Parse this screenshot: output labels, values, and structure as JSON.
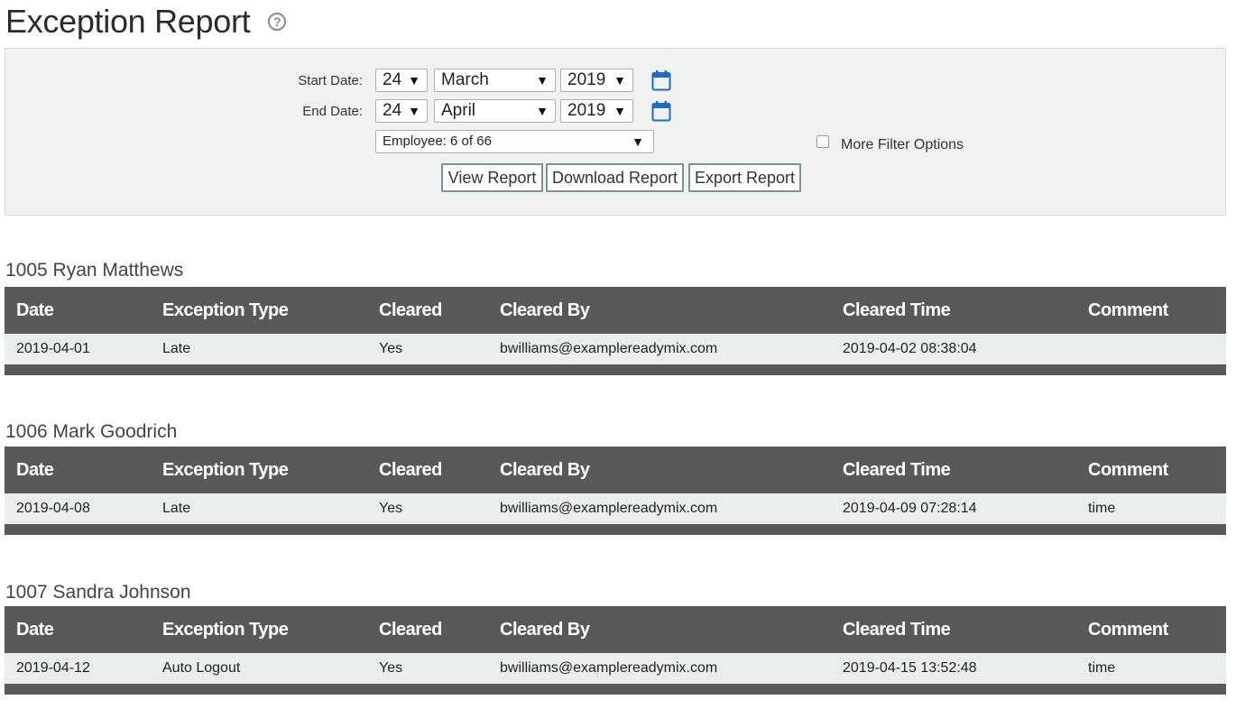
{
  "page": {
    "title": "Exception Report",
    "help_icon": "question-circle-icon"
  },
  "filters": {
    "start_label": "Start Date:",
    "start_day": "24",
    "start_month": "March",
    "start_year": "2019",
    "end_label": "End Date:",
    "end_day": "24",
    "end_month": "April",
    "end_year": "2019",
    "employee_select": "Employee: 6 of 66",
    "more_filter_label": "More Filter Options",
    "calendar_icon": "calendar-icon",
    "caret": "▼"
  },
  "buttons": {
    "view": "View Report",
    "download": "Download Report",
    "export": "Export Report"
  },
  "table_headers": [
    "Date",
    "Exception Type",
    "Cleared",
    "Cleared By",
    "Cleared Time",
    "Comment"
  ],
  "employees": [
    {
      "heading": "1005 Ryan Matthews",
      "rows": [
        {
          "date": "2019-04-01",
          "type": "Late",
          "cleared": "Yes",
          "cleared_by": "bwilliams@examplereadymix.com",
          "cleared_time": "2019-04-02 08:38:04",
          "comment": ""
        }
      ]
    },
    {
      "heading": "1006 Mark Goodrich",
      "rows": [
        {
          "date": "2019-04-08",
          "type": "Late",
          "cleared": "Yes",
          "cleared_by": "bwilliams@examplereadymix.com",
          "cleared_time": "2019-04-09 07:28:14",
          "comment": "time"
        }
      ]
    },
    {
      "heading": "1007 Sandra Johnson",
      "rows": [
        {
          "date": "2019-04-12",
          "type": "Auto Logout",
          "cleared": "Yes",
          "cleared_by": "bwilliams@examplereadymix.com",
          "cleared_time": "2019-04-15 13:52:48",
          "comment": "time"
        }
      ]
    }
  ],
  "colors": {
    "header_bg": "#58595b",
    "row_bg": "#eaeeee",
    "panel_bg": "#f0f2f2",
    "calendar_blue": "#1e6bc6",
    "button_border": "#7a9496"
  }
}
